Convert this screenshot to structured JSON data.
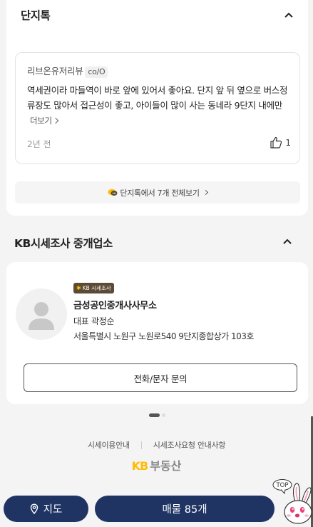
{
  "danji_talk": {
    "title": "단지톡",
    "review": {
      "reviewer": "리브온유저리뷰",
      "badge": "co/O",
      "text": "역세권이라 마들역이 바로 앞에 있어서 좋아요. 단지 앞 뒤 옆으로 버스정류장도 많아서 접근성이 좋고, 아이들이 많이 사는 동네라 9단지 내에만",
      "more_label": "더보기",
      "time": "2년 전",
      "like_count": "1"
    },
    "view_all_label": "단지톡에서 7개 전체보기"
  },
  "broker_section": {
    "title": "KB시세조사 중개업소",
    "badge": "KB 시세조사",
    "name": "금성공인중개사사무소",
    "representative": "대표 곽정순",
    "address": "서울특별시 노원구 노원로540 9단지종합상가 103호",
    "contact_label": "전화/문자 문의"
  },
  "pagination": {
    "current": 1,
    "total": 2
  },
  "footer": {
    "link1": "시세이용안내",
    "link2": "시세조사요청 안내사항",
    "logo_kb": "KB",
    "logo_text": "부동산"
  },
  "bottom_bar": {
    "map_label": "지도",
    "listing_label": "매물 85개",
    "top_label": "TOP"
  },
  "colors": {
    "navy": "#203464",
    "kb_yellow": "#ffbc00",
    "badge_brown": "#5b4a35"
  }
}
